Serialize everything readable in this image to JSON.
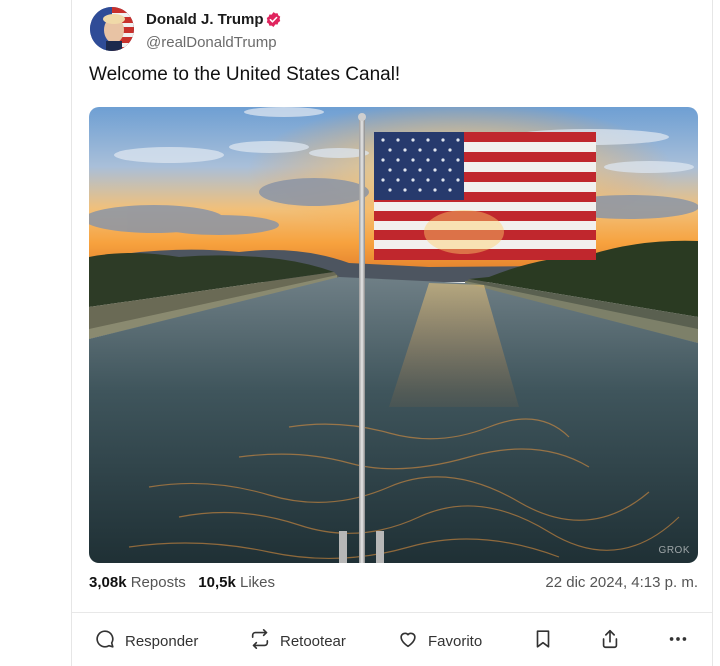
{
  "author": {
    "name": "Donald J. Trump",
    "handle": "@realDonaldTrump",
    "verified": true,
    "verified_color": "#e0245e"
  },
  "post": {
    "text": "Welcome to the United States Canal!",
    "image_alt": "American flag flying over a canal at sunset",
    "watermark": "GROK"
  },
  "stats": {
    "reposts_count": "3,08k",
    "reposts_label": "Reposts",
    "likes_count": "10,5k",
    "likes_label": "Likes",
    "date": "22 dic 2024, 4:13 p. m."
  },
  "actions": {
    "reply": "Responder",
    "retweet": "Retootear",
    "favorite": "Favorito"
  },
  "icons": [
    "verified-badge-icon",
    "reply-icon",
    "retweet-icon",
    "heart-icon",
    "bookmark-icon",
    "share-icon",
    "more-icon"
  ]
}
